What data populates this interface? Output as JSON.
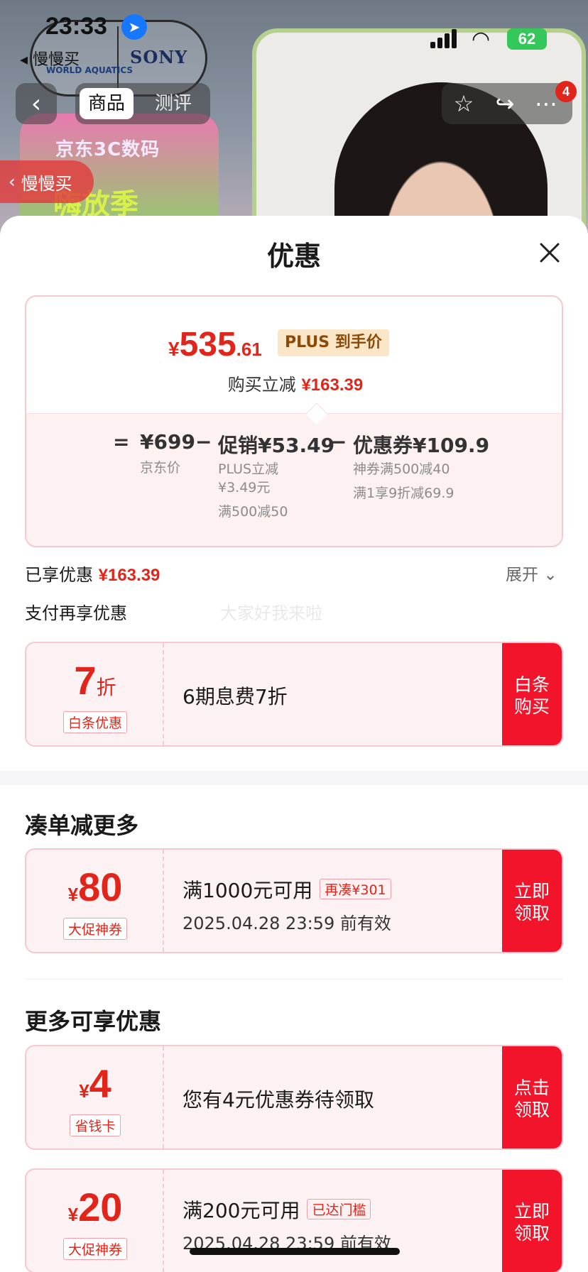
{
  "status_bar": {
    "time": "23:33",
    "back_app": "◂ 慢慢买",
    "battery": "62"
  },
  "background": {
    "logo_left": "WORLD AQUATICS",
    "logo_right": "SONY",
    "promo_line1": "京东3C数码",
    "promo_line2": "嗨放季"
  },
  "nav": {
    "tabs": [
      {
        "label": "商品",
        "active": true
      },
      {
        "label": "测评",
        "active": false
      }
    ],
    "cart_badge": "4",
    "side_tag": "慢慢买"
  },
  "sheet": {
    "title": "优惠",
    "price": {
      "yen": "¥",
      "int": "535",
      "dec": ".61",
      "tag": "PLUS 到手价",
      "save_label": "购买立减",
      "save_amount": "¥163.39"
    },
    "formula": [
      {
        "op": "=",
        "label": "¥699",
        "notes": [
          "京东价"
        ]
      },
      {
        "op": "−",
        "label": "促销¥53.49",
        "notes": [
          "PLUS立减",
          "¥3.49元",
          "满500减50"
        ]
      },
      {
        "op": "−",
        "label": "优惠券¥109.9",
        "notes": [
          "神券满500减40",
          "满1享9折减69.9"
        ]
      }
    ],
    "enjoyed_label": "已享优惠",
    "enjoyed_amount": "¥163.39",
    "expand_label": "展开",
    "pay_more_label": "支付再享优惠",
    "watermark": "大家好我来啦",
    "pay_coupon": {
      "num": "7",
      "unit": "折",
      "tag": "白条优惠",
      "desc": "6期息费7折",
      "btn": "白条购买"
    },
    "section_more_order": "凑单减更多",
    "order_coupon": {
      "yen": "¥",
      "num": "80",
      "tag": "大促神券",
      "line1": "满1000元可用",
      "pill": "再凑¥301",
      "line2": "2025.04.28 23:59 前有效",
      "btn": "立即领取"
    },
    "section_more": "更多可享优惠",
    "more_coupons": [
      {
        "yen": "¥",
        "num": "4",
        "tag": "省钱卡",
        "desc": "您有4元优惠券待领取",
        "btn": "点击领取"
      },
      {
        "yen": "¥",
        "num": "20",
        "tag": "大促神券",
        "line1": "满200元可用",
        "pill": "已达门槛",
        "line2": "2025.04.28 23:59 前有效",
        "btn": "立即领取"
      }
    ]
  },
  "colors": {
    "accent": "#e1251b",
    "button": "#f2142a",
    "plus_bg": "#fbe6c7",
    "card_border": "#f6c8cf"
  }
}
